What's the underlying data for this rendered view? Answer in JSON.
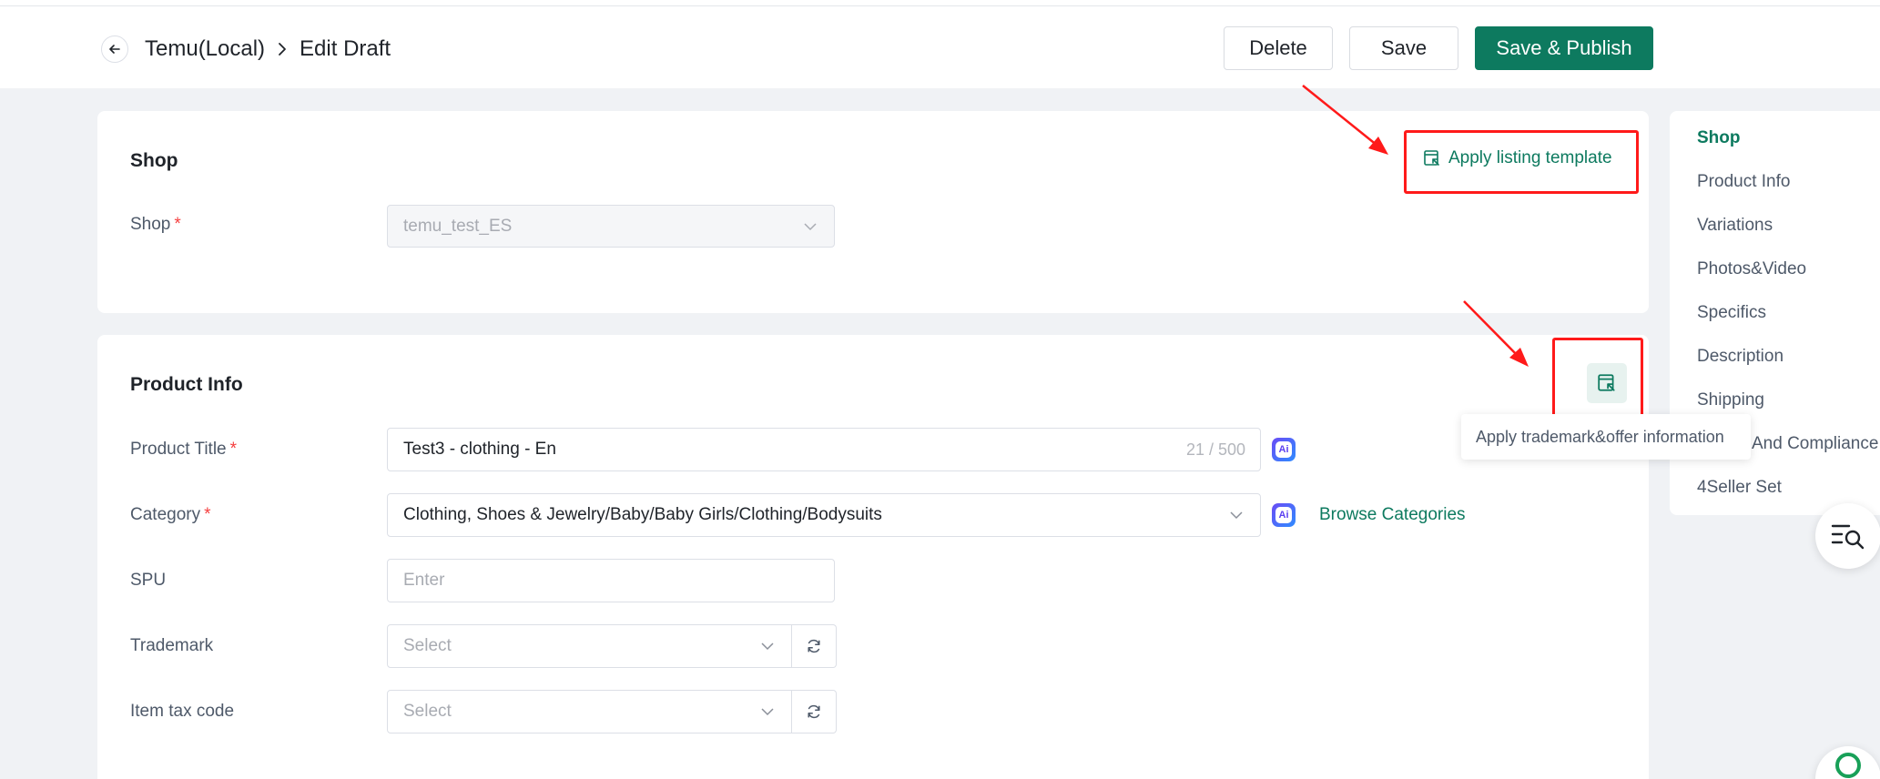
{
  "header": {
    "breadcrumb_root": "Temu(Local)",
    "breadcrumb_current": "Edit Draft",
    "delete_label": "Delete",
    "save_label": "Save",
    "publish_label": "Save & Publish"
  },
  "shop_card": {
    "title": "Shop",
    "apply_template_label": "Apply listing template",
    "shop_label": "Shop",
    "shop_value": "temu_test_ES"
  },
  "product_card": {
    "title": "Product Info",
    "tooltip": "Apply trademark&offer information",
    "product_title_label": "Product Title",
    "product_title_value": "Test3 - clothing - En",
    "product_title_count": "21 / 500",
    "category_label": "Category",
    "category_value": "Clothing, Shoes & Jewelry/Baby/Baby Girls/Clothing/Bodysuits",
    "browse_categories": "Browse Categories",
    "spu_label": "SPU",
    "spu_placeholder": "Enter",
    "trademark_label": "Trademark",
    "trademark_placeholder": "Select",
    "tax_label": "Item tax code",
    "tax_placeholder": "Select",
    "required_mark": "*",
    "ai_text": "Ai"
  },
  "sidenav": {
    "items": [
      {
        "label": "Shop",
        "active": true
      },
      {
        "label": "Product Info"
      },
      {
        "label": "Variations"
      },
      {
        "label": "Photos&Video"
      },
      {
        "label": "Specifics"
      },
      {
        "label": "Description"
      },
      {
        "label": "Shipping"
      },
      {
        "label": "And Compliance"
      },
      {
        "label": "4Seller Set"
      }
    ]
  },
  "colors": {
    "brand": "#0d7a5f",
    "annotation": "#ff1a1a",
    "required": "#f53f3f"
  },
  "icons": [
    "back-arrow-icon",
    "chevron-right-icon",
    "template-icon",
    "chevron-down-icon",
    "refresh-icon",
    "ai-icon",
    "search-list-icon"
  ]
}
